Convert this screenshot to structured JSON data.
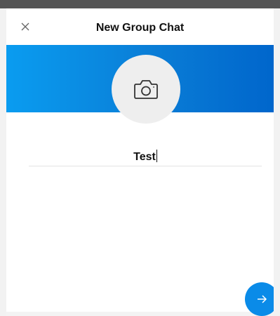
{
  "header": {
    "title": "New Group Chat",
    "close_icon": "close-icon"
  },
  "banner": {
    "gradient_start": "#0a9cf0",
    "gradient_end": "#0066cc"
  },
  "avatar": {
    "icon": "camera-icon"
  },
  "group_name": {
    "value": "Test"
  },
  "next_button": {
    "icon": "arrow-right-icon",
    "color": "#0a8be8"
  }
}
